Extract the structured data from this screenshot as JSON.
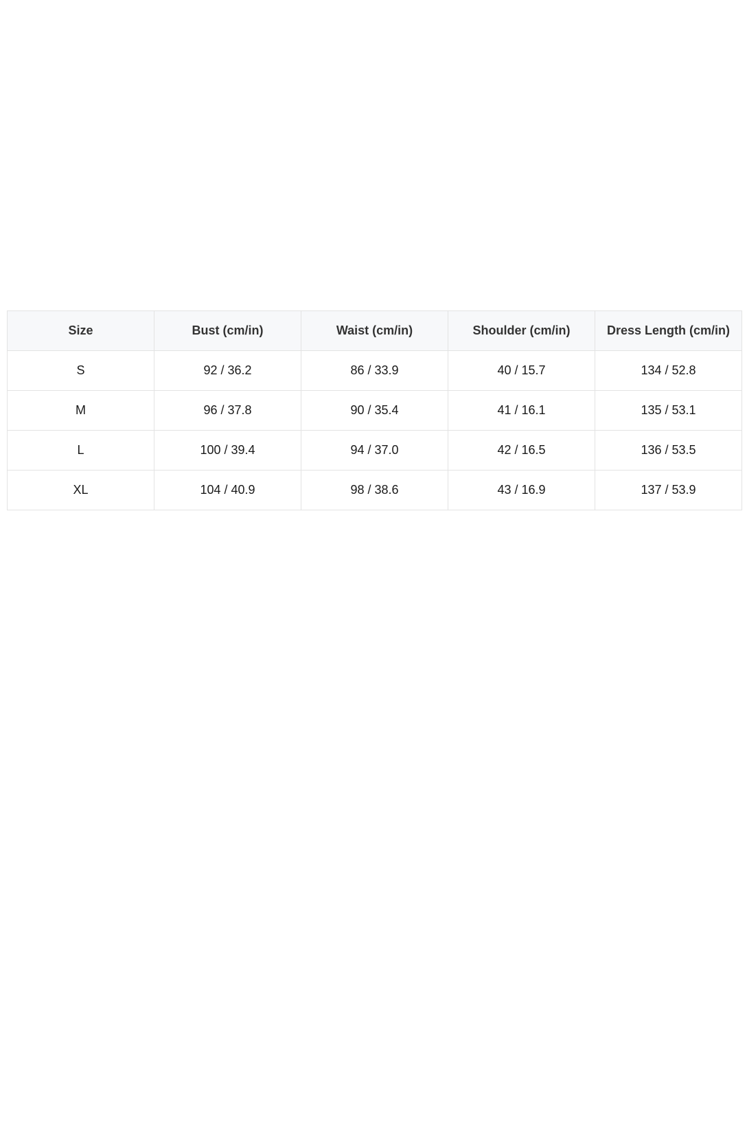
{
  "size_table": {
    "headers": [
      "Size",
      "Bust (cm/in)",
      "Waist (cm/in)",
      "Shoulder (cm/in)",
      "Dress Length (cm/in)"
    ],
    "rows": [
      [
        "S",
        "92 / 36.2",
        "86 / 33.9",
        "40 / 15.7",
        "134 / 52.8"
      ],
      [
        "M",
        "96 / 37.8",
        "90 / 35.4",
        "41 / 16.1",
        "135 / 53.1"
      ],
      [
        "L",
        "100 / 39.4",
        "94 / 37.0",
        "42 / 16.5",
        "136 / 53.5"
      ],
      [
        "XL",
        "104 / 40.9",
        "98 / 38.6",
        "43 / 16.9",
        "137 / 53.9"
      ]
    ]
  },
  "colors": {
    "header_background": "#f7f8fa",
    "border": "#e3e3e3",
    "text": "#1a1a1a"
  }
}
